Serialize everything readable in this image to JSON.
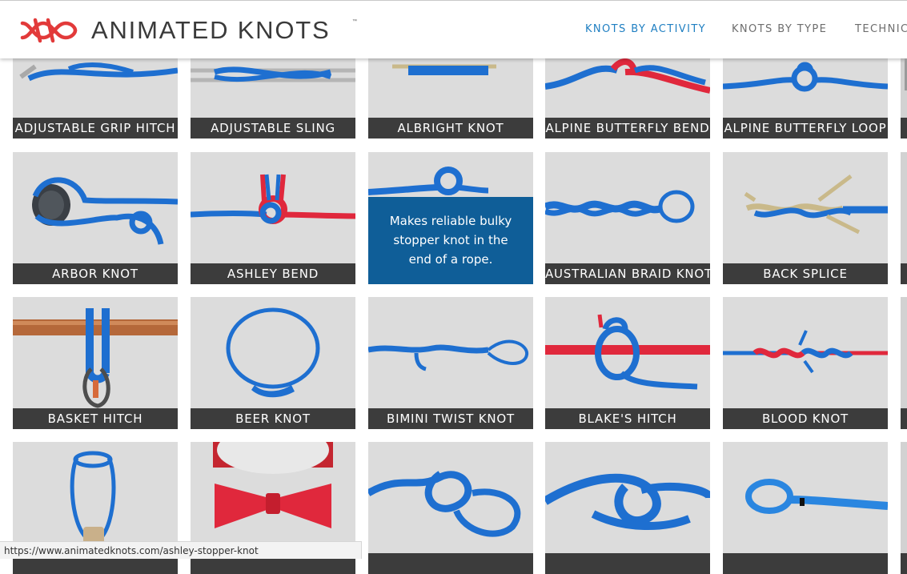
{
  "brand": {
    "name": "ANIMATED KNOTS",
    "trademark": "™",
    "logo_color": "#e23a3a",
    "logo_icon": "knot-logo-icon"
  },
  "nav": {
    "items": [
      {
        "label": "KNOTS BY ACTIVITY",
        "active": true
      },
      {
        "label": "KNOTS BY TYPE",
        "active": false
      },
      {
        "label": "TECHNIC..",
        "active": false
      }
    ],
    "active_color": "#1f7fc2"
  },
  "knots": [
    {
      "label": "ADJUSTABLE GRIP HITCH"
    },
    {
      "label": "ADJUSTABLE SLING"
    },
    {
      "label": "ALBRIGHT KNOT"
    },
    {
      "label": "ALPINE BUTTERFLY BEND"
    },
    {
      "label": "ALPINE BUTTERFLY LOOP"
    },
    {
      "label": "ARBOR KNOT"
    },
    {
      "label": "ASHLEY BEND"
    },
    {
      "label": "",
      "hover_text": "Makes reliable bulky stopper knot in the end of a rope.",
      "hovered": true
    },
    {
      "label": "AUSTRALIAN BRAID KNOT"
    },
    {
      "label": "BACK SPLICE"
    },
    {
      "label": "BASKET HITCH"
    },
    {
      "label": "BEER KNOT"
    },
    {
      "label": "BIMINI TWIST KNOT"
    },
    {
      "label": "BLAKE'S HITCH"
    },
    {
      "label": "BLOOD KNOT"
    },
    {
      "label": ""
    },
    {
      "label": ""
    },
    {
      "label": ""
    },
    {
      "label": ""
    },
    {
      "label": ""
    }
  ],
  "status_url": "https://www.animatedknots.com/ashley-stopper-knot",
  "colors": {
    "tile_bg": "#dcdcdc",
    "caption_bg": "#3c3c3c",
    "hover_bg": "#0f5e98",
    "rope_blue": "#1e6fd0",
    "rope_red": "#e0283c"
  }
}
